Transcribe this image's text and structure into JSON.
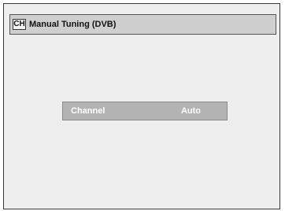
{
  "title_bar": {
    "icon": "ch-icon",
    "icon_text": "CH",
    "title": "Manual Tuning (DVB)"
  },
  "settings": {
    "channel": {
      "label": "Channel",
      "value": "Auto"
    }
  },
  "colors": {
    "screen_background": "#eeeeee",
    "title_bar_background": "#cfcfcf",
    "row_background": "#b3b3b3",
    "row_text": "#ffffff",
    "border": "#3a3a3a"
  }
}
